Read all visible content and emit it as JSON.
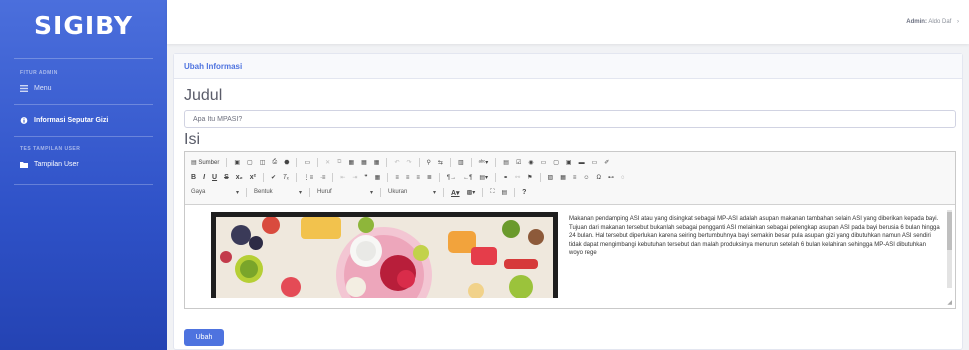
{
  "sidebar": {
    "brand": "SIGIBY",
    "section_admin": "FITUR ADMIN",
    "section_user": "TES TAMPILAN USER",
    "items": [
      {
        "label": "Menu",
        "icon": "menu-icon"
      },
      {
        "label": "Informasi Seputar Gizi",
        "icon": "info-icon"
      },
      {
        "label": "Tampilan User",
        "icon": "folder-icon"
      }
    ]
  },
  "topbar": {
    "role": "Admin:",
    "name": "Aldo Daf"
  },
  "card": {
    "title": "Ubah Informasi",
    "judul_label": "Judul",
    "judul_value": "Apa Itu MPASI?",
    "isi_label": "Isi",
    "submit_label": "Ubah"
  },
  "editor": {
    "source_label": "Sumber",
    "format_dropdowns": [
      "Gaya",
      "Bentuk",
      "Huruf",
      "Ukuran"
    ],
    "content": "Makanan pendamping ASI atau yang disingkat sebagai MP-ASI adalah asupan makanan tambahan selain ASI yang diberikan kepada bayi. Tujuan dari makanan tersebut bukanlah sebagai pengganti ASI melainkan sebagai pelengkap asupan ASI pada bayi berusia 6 bulan hingga 24 bulan. Hal tersebut diperlukan karena seiring bertumbuhnya bayi semakin besar pula asupan gizi yang dibutuhkan namun ASI sendiri tidak dapat mengimbangi kebutuhan tersebut dan malah produksinya menurun setelah 6 bulan kelahiran sehingga MP-ASI dibutuhkan woyo rege"
  },
  "colors": {
    "primary": "#4e73df",
    "sidebar": "#2f52c8"
  }
}
